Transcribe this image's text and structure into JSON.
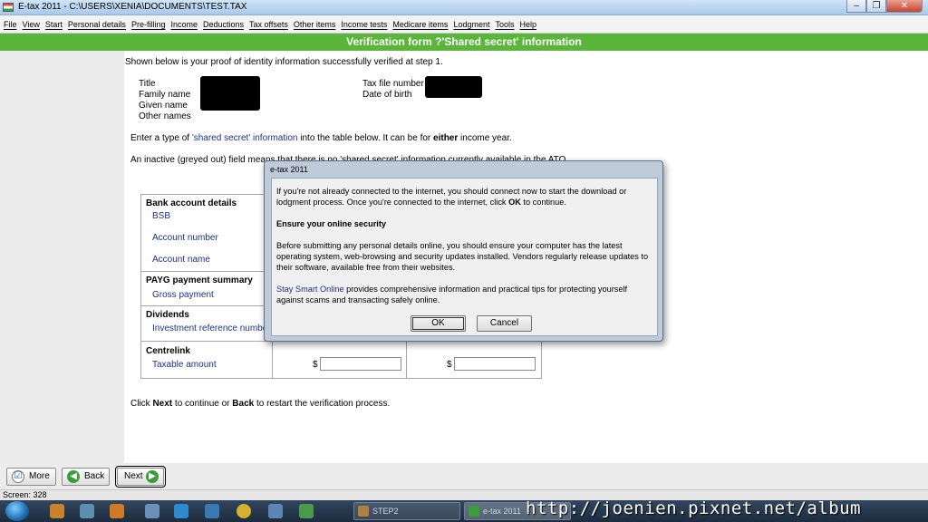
{
  "window": {
    "title": "E-tax 2011 - C:\\USERS\\XENIA\\DOCUMENTS\\TEST.TAX",
    "controls": {
      "minimize": "–",
      "maximize": "❐",
      "close": "✕"
    }
  },
  "menu": [
    "File",
    "View",
    "Start",
    "Personal details",
    "Pre-filling",
    "Income",
    "Deductions",
    "Tax offsets",
    "Other items",
    "Income tests",
    "Medicare items",
    "Lodgment",
    "Tools",
    "Help"
  ],
  "header": {
    "title": "Verification form ?'Shared secret' information"
  },
  "intro": "Shown below is your proof of identity information successfully verified at step 1.",
  "identity": {
    "left_labels": [
      "Title",
      "Family name",
      "Given name",
      "Other names"
    ],
    "right_labels": [
      "Tax file number",
      "Date of birth"
    ]
  },
  "instructions": {
    "line1_pre": "Enter a type of ",
    "line1_link": "'shared secret' information",
    "line1_mid": " into the table below. It can be for ",
    "line1_bold": "either",
    "line1_post": " income year.",
    "line2": "An inactive (greyed out) field means that there is no 'shared secret' information currently available in the ATO"
  },
  "table": {
    "sections": [
      {
        "heading": "Bank account details",
        "fields": [
          "BSB",
          "Account number",
          "Account name"
        ]
      },
      {
        "heading": "PAYG payment summary",
        "fields": [
          "Gross payment"
        ]
      },
      {
        "heading": "Dividends",
        "fields": [
          "Investment reference number"
        ]
      },
      {
        "heading": "Centrelink",
        "fields": [
          "Taxable amount"
        ]
      }
    ],
    "currency": "$"
  },
  "footer_text": {
    "pre": "Click ",
    "next": "Next",
    "mid": " to continue or ",
    "back": "Back",
    "post": " to restart the verification process."
  },
  "buttons": {
    "more": "More",
    "back": "Back",
    "next": "Next"
  },
  "status": "Screen: 328",
  "dialog": {
    "title": "e-tax 2011",
    "p1_pre": "If you're not already connected to the internet, you should connect now to start the download or lodgment process. Once you're connected to the internet, click ",
    "p1_ok": "OK",
    "p1_post": " to continue.",
    "heading": "Ensure your online security",
    "p2": "Before submitting any personal details online, you should ensure your computer has the latest operating system, web-browsing and security updates installed. Vendors regularly release updates to their software, available free from their websites.",
    "p3_link": "Stay Smart Online",
    "p3_rest": " provides comprehensive information and practical tips for protecting yourself against scams and transacting safely online.",
    "ok": "OK",
    "cancel": "Cancel"
  },
  "taskbar": {
    "tasks": [
      "STEP2",
      "e-tax 2011"
    ]
  },
  "watermark": "http://joenien.pixnet.net/album"
}
